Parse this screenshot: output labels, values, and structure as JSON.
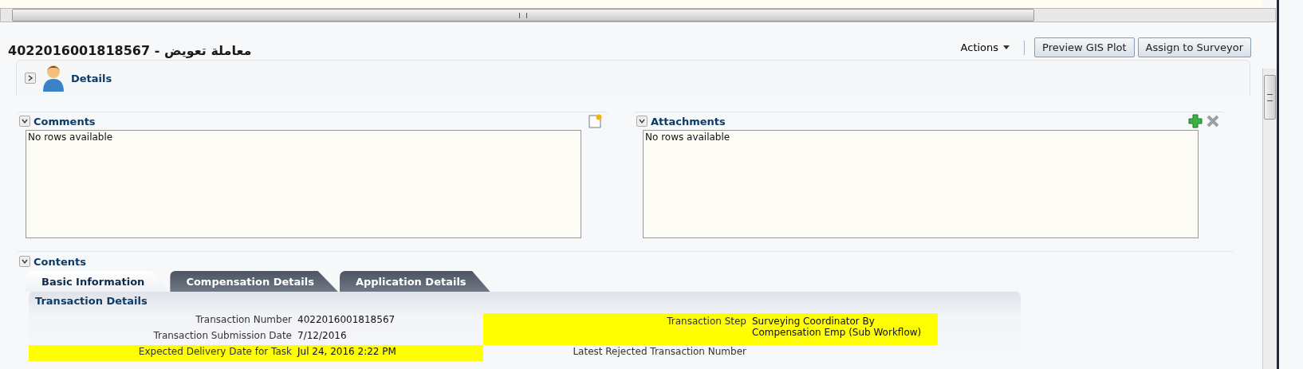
{
  "page_title": "4022016001818567 - معاملة تعويض",
  "toolbar": {
    "actions_menu": "Actions",
    "buttons": [
      "Preview GIS Plot",
      "Assign to Surveyor"
    ]
  },
  "details_section": {
    "title": "Details",
    "expanded": false
  },
  "comments": {
    "title": "Comments",
    "expanded": true,
    "empty_text": "No rows available"
  },
  "attachments": {
    "title": "Attachments",
    "expanded": true,
    "empty_text": "No rows available"
  },
  "contents": {
    "title": "Contents",
    "expanded": true,
    "tabs": [
      {
        "label": "Basic Information",
        "selected": true
      },
      {
        "label": "Compensation Details",
        "selected": false
      },
      {
        "label": "Application Details",
        "selected": false
      }
    ],
    "panel_title": "Transaction Details",
    "left_fields": [
      {
        "label": "Transaction Number",
        "value": "4022016001818567",
        "highlighted": false
      },
      {
        "label": "Transaction Submission Date",
        "value": "7/12/2016",
        "highlighted": false
      },
      {
        "label": "Expected Delivery Date for Task",
        "value": "Jul 24, 2016 2:22 PM",
        "highlighted": true
      }
    ],
    "right_fields": [
      {
        "label": "Transaction Step",
        "value": "Surveying Coordinator By Compensation Emp (Sub Workflow)",
        "highlighted": true
      },
      {
        "label": "Latest Rejected Transaction Number",
        "highlighted": false
      }
    ]
  }
}
